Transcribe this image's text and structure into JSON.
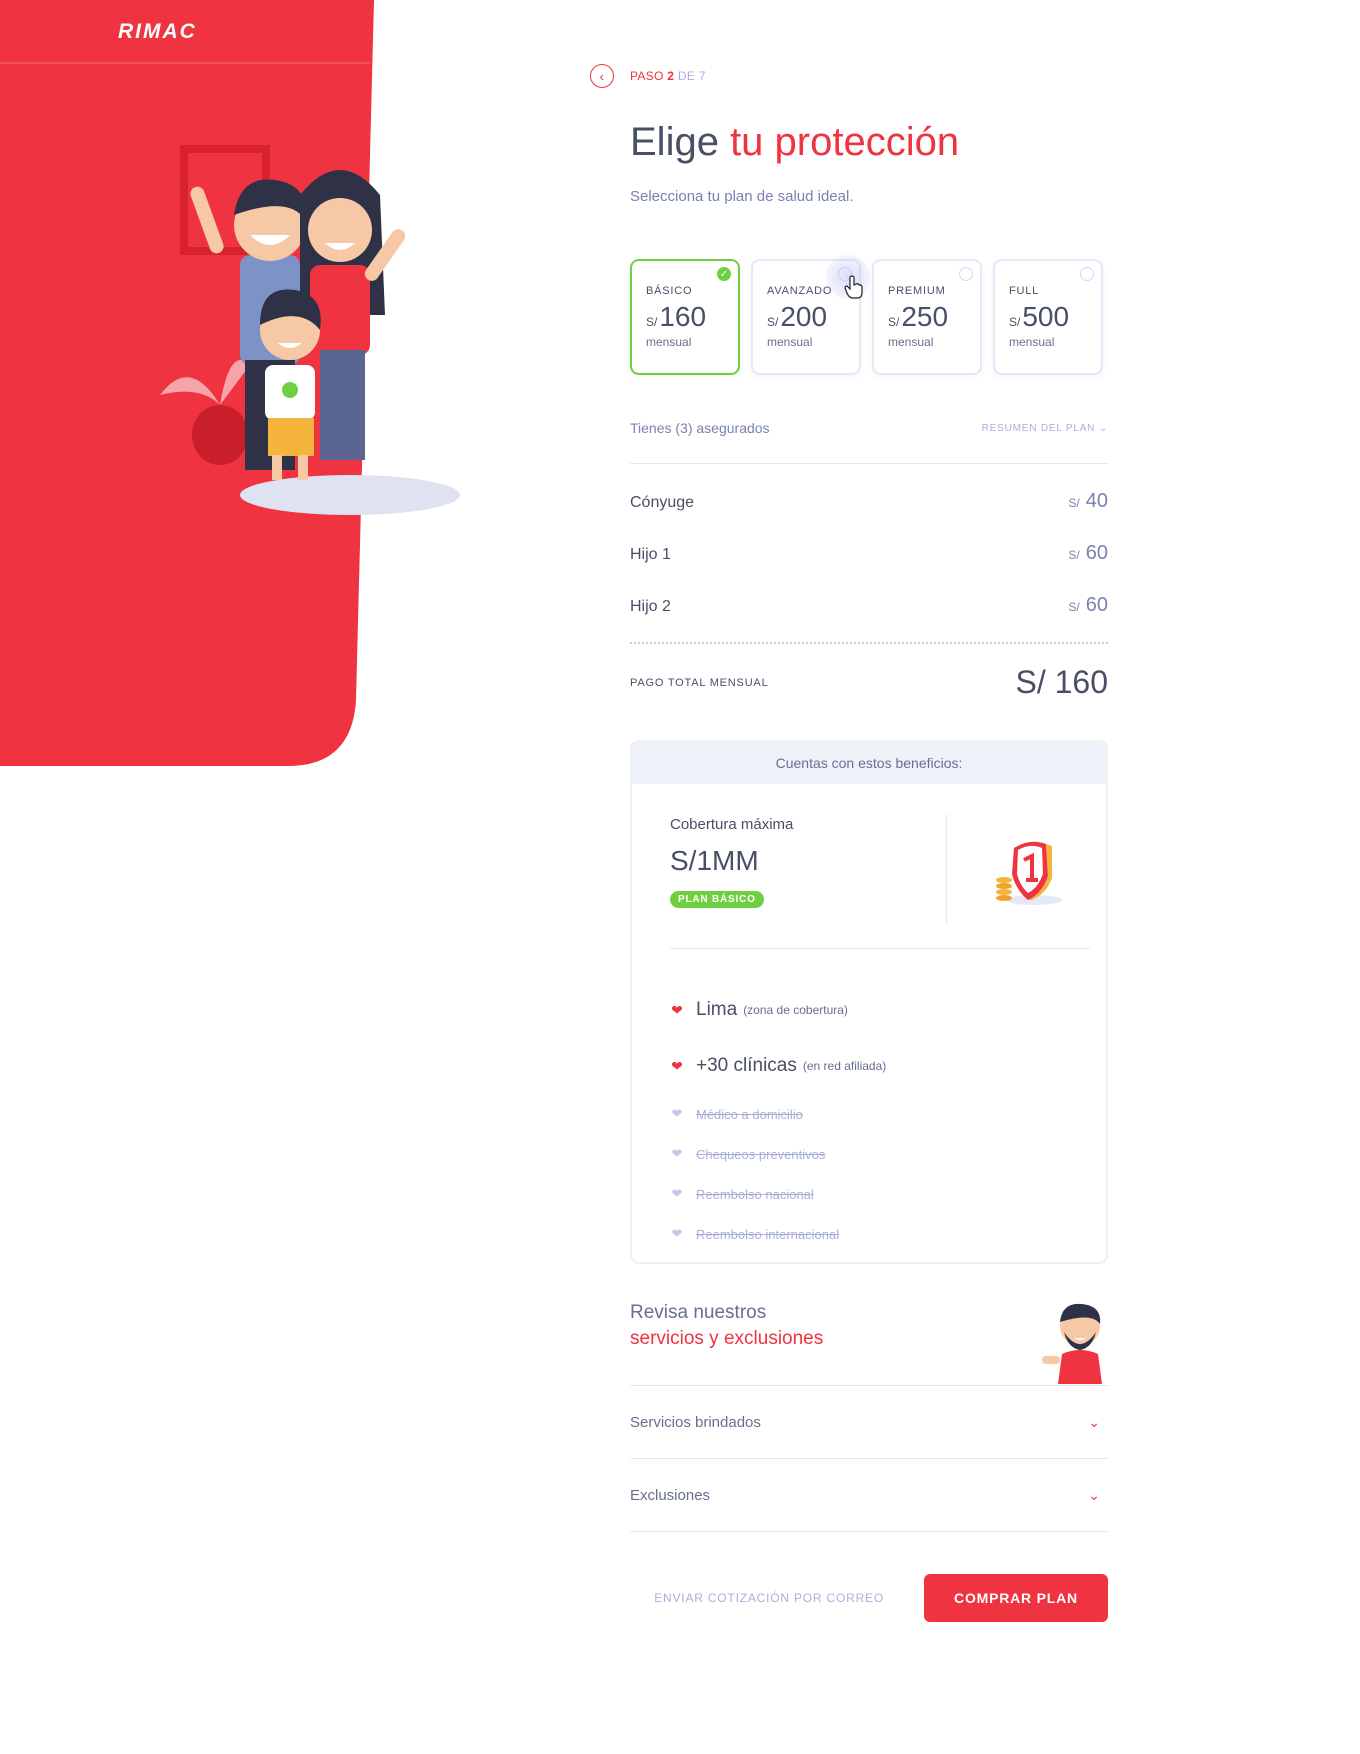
{
  "brand": {
    "name": "RIMAC",
    "color": "#ef3340"
  },
  "step": {
    "prefix": "PASO",
    "current": "2",
    "total": "DE 7"
  },
  "title": {
    "part1": "Elige ",
    "accent": "tu protección"
  },
  "subtitle": "Selecciona tu plan de salud ideal.",
  "plans": [
    {
      "name": "BÁSICO",
      "currency": "S/",
      "amount": "160",
      "period": "mensual",
      "selected": true
    },
    {
      "name": "AVANZADO",
      "currency": "S/",
      "amount": "200",
      "period": "mensual",
      "selected": false
    },
    {
      "name": "PREMIUM",
      "currency": "S/",
      "amount": "250",
      "period": "mensual",
      "selected": false
    },
    {
      "name": "FULL",
      "currency": "S/",
      "amount": "500",
      "period": "mensual",
      "selected": false
    }
  ],
  "insured": {
    "text": "Tienes (3) asegurados",
    "summary_link": "RESUMEN DEL PLAN"
  },
  "members": [
    {
      "name": "Cónyuge",
      "currency": "S/",
      "amount": "40"
    },
    {
      "name": "Hijo 1",
      "currency": "S/",
      "amount": "60"
    },
    {
      "name": "Hijo 2",
      "currency": "S/",
      "amount": "60"
    }
  ],
  "total": {
    "label": "PAGO TOTAL MENSUAL",
    "value": "S/ 160"
  },
  "benefits": {
    "header": "Cuentas con estos beneficios:",
    "coverage_label": "Cobertura máxima",
    "coverage_value": "S/1MM",
    "plan_badge": "PLAN BÁSICO",
    "active": [
      {
        "main": "Lima",
        "note": "(zona de cobertura)"
      },
      {
        "main": "+30 clínicas",
        "note": "(en red afiliada)"
      }
    ],
    "inactive": [
      "Médico a domicilio",
      "Chequeos preventivos",
      "Reembolso nacional",
      "Reembolso internacional"
    ]
  },
  "review": {
    "line1": "Revisa nuestros",
    "line2": "servicios y exclusiones"
  },
  "accordions": [
    {
      "label": "Servicios brindados"
    },
    {
      "label": "Exclusiones"
    }
  ],
  "actions": {
    "email_label": "ENVIAR COTIZACIÓN POR CORREO",
    "buy_label": "COMPRAR PLAN"
  },
  "icons": {
    "back": "chevron-left-icon",
    "check": "check-icon",
    "heart": "heart-icon",
    "chevron_down": "chevron-down-icon",
    "shield": "shield-coins-icon"
  },
  "colors": {
    "accent": "#ef3340",
    "success": "#6fcf40",
    "text": "#494f66",
    "muted": "#a9afd9"
  }
}
